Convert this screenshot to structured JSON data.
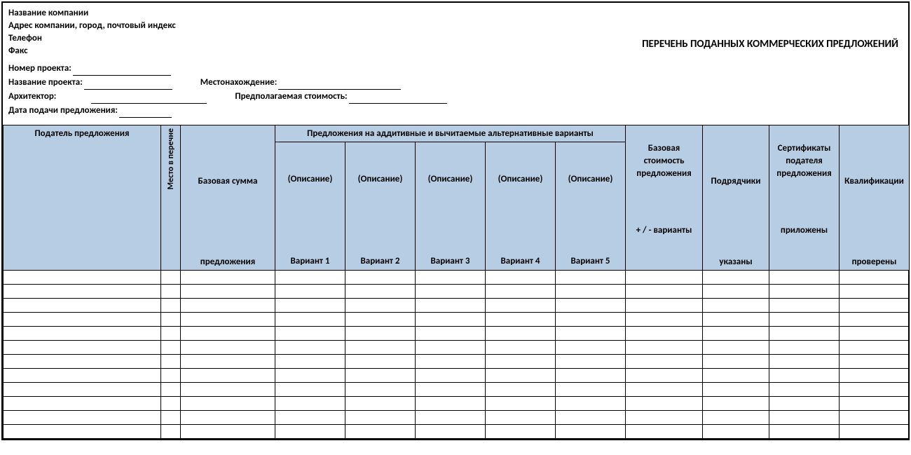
{
  "company": {
    "name": "Название компании",
    "address": "Адрес компании, город, почтовый индекс",
    "phone": "Телефон",
    "fax": "Факс"
  },
  "doc_title": "ПЕРЕЧЕНЬ ПОДАННЫХ КОММЕРЧЕСКИХ ПРЕДЛОЖЕНИЙ",
  "meta": {
    "project_number_lbl": "Номер проекта:",
    "project_name_lbl": "Название проекта:",
    "architect_lbl": "Архитектор:",
    "bid_date_lbl": "Дата подачи предложения:",
    "location_lbl": "Местонахождение:",
    "est_cost_lbl": "Предполагаемая стоимость:"
  },
  "headers": {
    "bidder": "Податель предложения",
    "rank": "Место в перечне",
    "base_amount_top": "Базовая сумма",
    "base_amount_bot": "предложения",
    "alts_span": "Предложения на аддитивные и вычитаемые альтернативные варианты",
    "desc": "(Описание)",
    "var1": "Вариант 1",
    "var2": "Вариант 2",
    "var3": "Вариант 3",
    "var4": "Вариант 4",
    "var5": "Вариант 5",
    "base_cost_top": "Базовая стоимость предложения",
    "base_cost_bot": "+ / - варианты",
    "contractors_top": "Подрядчики",
    "contractors_bot": "указаны",
    "certs_top": "Сертификаты подателя предложения",
    "certs_bot": "приложены",
    "quals_top": "Квалификации",
    "quals_bot": "проверены"
  },
  "row_count": 12
}
